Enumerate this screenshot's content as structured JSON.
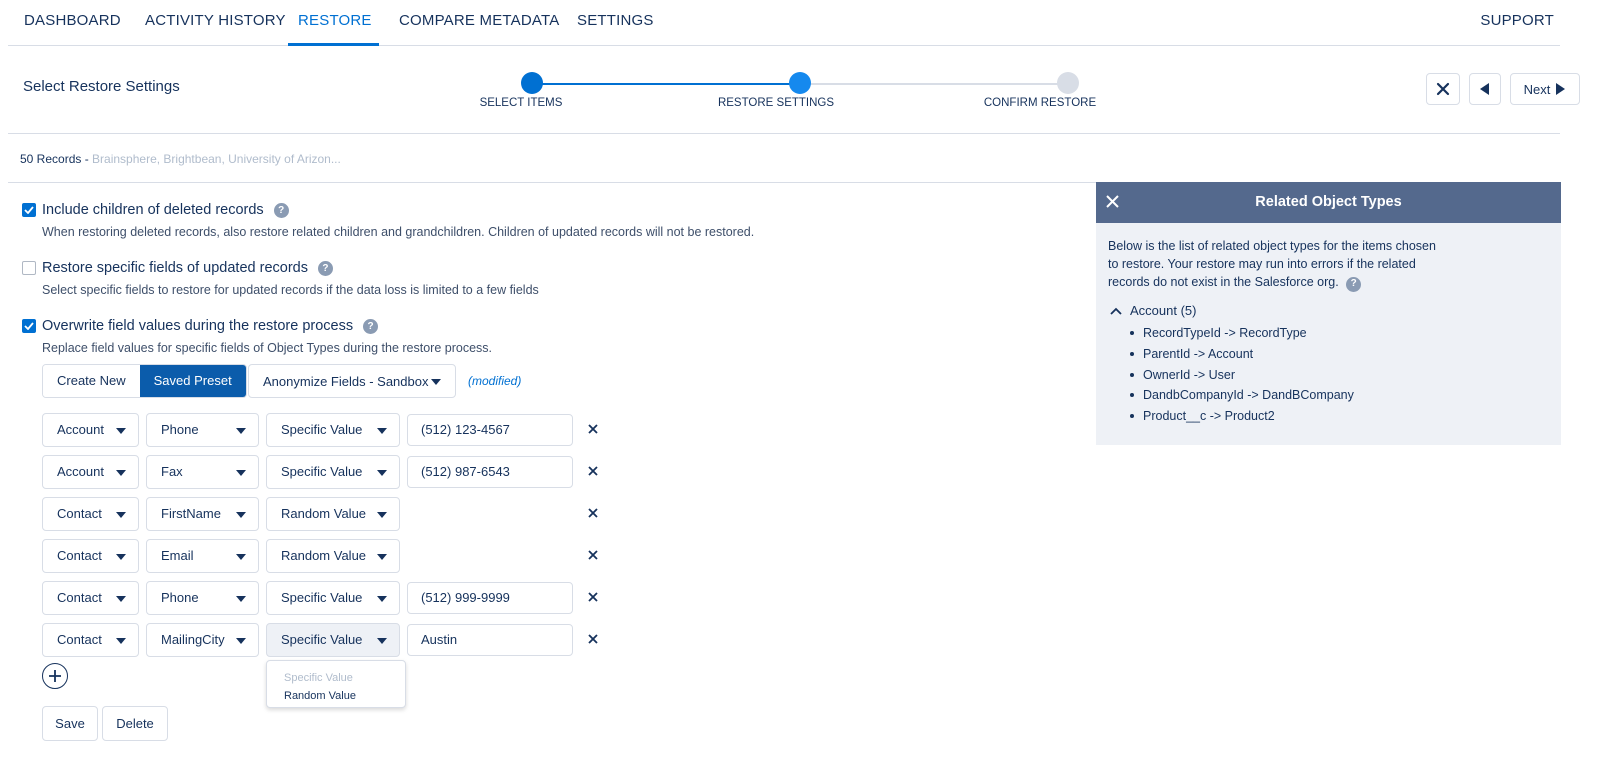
{
  "nav": {
    "tabs": [
      {
        "label": "DASHBOARD"
      },
      {
        "label": "ACTIVITY HISTORY"
      },
      {
        "label": "RESTORE"
      },
      {
        "label": "COMPARE METADATA"
      },
      {
        "label": "SETTINGS"
      }
    ],
    "active_tab": "RESTORE",
    "support": "SUPPORT"
  },
  "wizard": {
    "title": "Select Restore Settings",
    "steps": [
      {
        "label": "SELECT ITEMS",
        "state": "complete"
      },
      {
        "label": "RESTORE SETTINGS",
        "state": "current"
      },
      {
        "label": "CONFIRM RESTORE",
        "state": "pending"
      }
    ],
    "next_label": "Next"
  },
  "records": {
    "count": "50 Records -",
    "names": "Brainsphere, Brightbean, University of Arizon..."
  },
  "options": [
    {
      "label": "Include children of deleted records",
      "checked": true,
      "description": "When restoring deleted records, also restore related children and grandchildren. Children of updated records will not be restored."
    },
    {
      "label": "Restore specific fields of updated records",
      "checked": false,
      "description": "Select specific fields to restore for updated records if the data loss is limited to a few fields"
    },
    {
      "label": "Overwrite field values during the restore process",
      "checked": true,
      "description": "Replace field values for specific fields of Object Types during the restore process."
    }
  ],
  "preset": {
    "create_new": "Create New",
    "saved_preset": "Saved Preset",
    "selected": "Anonymize Fields - Sandbox",
    "modified": "(modified)"
  },
  "overwrite_rows": [
    {
      "object": "Account",
      "field": "Phone",
      "mode": "Specific Value",
      "value": "(512) 123-4567"
    },
    {
      "object": "Account",
      "field": "Fax",
      "mode": "Specific Value",
      "value": "(512) 987-6543"
    },
    {
      "object": "Contact",
      "field": "FirstName",
      "mode": "Random Value",
      "value": ""
    },
    {
      "object": "Contact",
      "field": "Email",
      "mode": "Random Value",
      "value": ""
    },
    {
      "object": "Contact",
      "field": "Phone",
      "mode": "Specific Value",
      "value": "(512) 999-9999"
    },
    {
      "object": "Contact",
      "field": "MailingCity",
      "mode": "Specific Value",
      "value": "Austin"
    }
  ],
  "mode_dropdown": {
    "options": [
      "Specific Value",
      "Random Value"
    ]
  },
  "actions": {
    "save": "Save",
    "delete": "Delete"
  },
  "related_panel": {
    "title": "Related Object Types",
    "description": "Below is the list of related object types for the items chosen to restore. Your restore may run into errors if the related records do not exist in the Salesforce org.",
    "group_label": "Account (5)",
    "items": [
      "RecordTypeId -> RecordType",
      "ParentId -> Account",
      "OwnerId -> User",
      "DandbCompanyId -> DandBCompany",
      "Product__c -> Product2"
    ]
  },
  "colors": {
    "accent": "#0070d2",
    "panel_header": "#54698d",
    "text": "#16325c"
  }
}
